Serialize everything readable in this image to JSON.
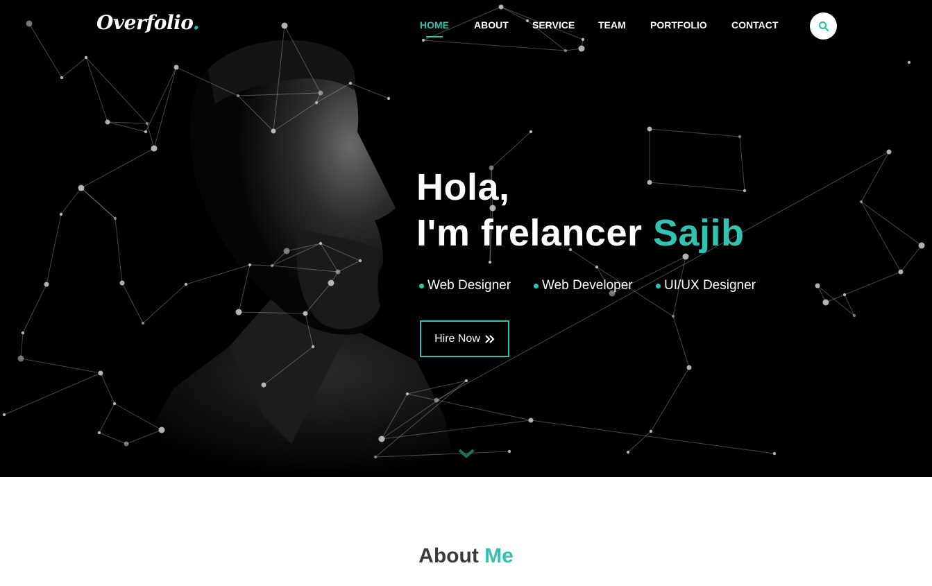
{
  "brand": {
    "logo_main": "Overfolio",
    "logo_dot": "."
  },
  "nav": {
    "items": [
      {
        "label": "HOME",
        "active": true
      },
      {
        "label": "ABOUT",
        "active": false
      },
      {
        "label": "SERVICE",
        "active": false
      },
      {
        "label": "TEAM",
        "active": false
      },
      {
        "label": "PORTFOLIO",
        "active": false
      },
      {
        "label": "CONTACT",
        "active": false
      }
    ],
    "search_icon": "search-icon"
  },
  "hero": {
    "greeting": "Hola,",
    "intro_prefix": "I'm frelancer ",
    "name": "Sajib",
    "roles": [
      "Web Designer",
      "Web Developer",
      "UI/UX Designer"
    ],
    "cta_label": "Hire Now",
    "cta_icon": "double-chevron-right-icon",
    "scroll_icon": "chevron-down-icon"
  },
  "about": {
    "title_main": "About ",
    "title_accent": "Me"
  },
  "colors": {
    "accent": "#2fc4b2",
    "hero_bg": "#000000",
    "text_dark": "#3a3a3a",
    "white": "#ffffff"
  }
}
